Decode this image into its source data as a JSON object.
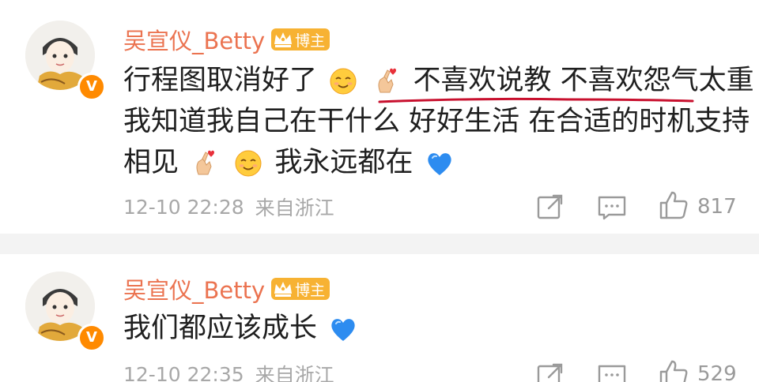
{
  "colors": {
    "username": "#eb7350",
    "verified_badge": "#ff8a00",
    "crown_badge": "#f7b233",
    "heart": "#2d8cf0",
    "annotation": "#c8102e"
  },
  "comments": [
    {
      "username": "吴宣仪_Betty",
      "badge": "博主",
      "lines": [
        "行程图取消好了",
        "不喜欢说教 不喜欢怨气太重",
        "我知道我自己在干什么 好好生活 在合适的时机支持",
        "相见",
        "我永远都在"
      ],
      "time": "12-10 22:28",
      "location": "来自浙江",
      "likes": "817"
    },
    {
      "username": "吴宣仪_Betty",
      "badge": "博主",
      "lines": [
        "我们都应该成长"
      ],
      "time": "12-10 22:35",
      "location": "来自浙江",
      "likes": "529"
    }
  ]
}
